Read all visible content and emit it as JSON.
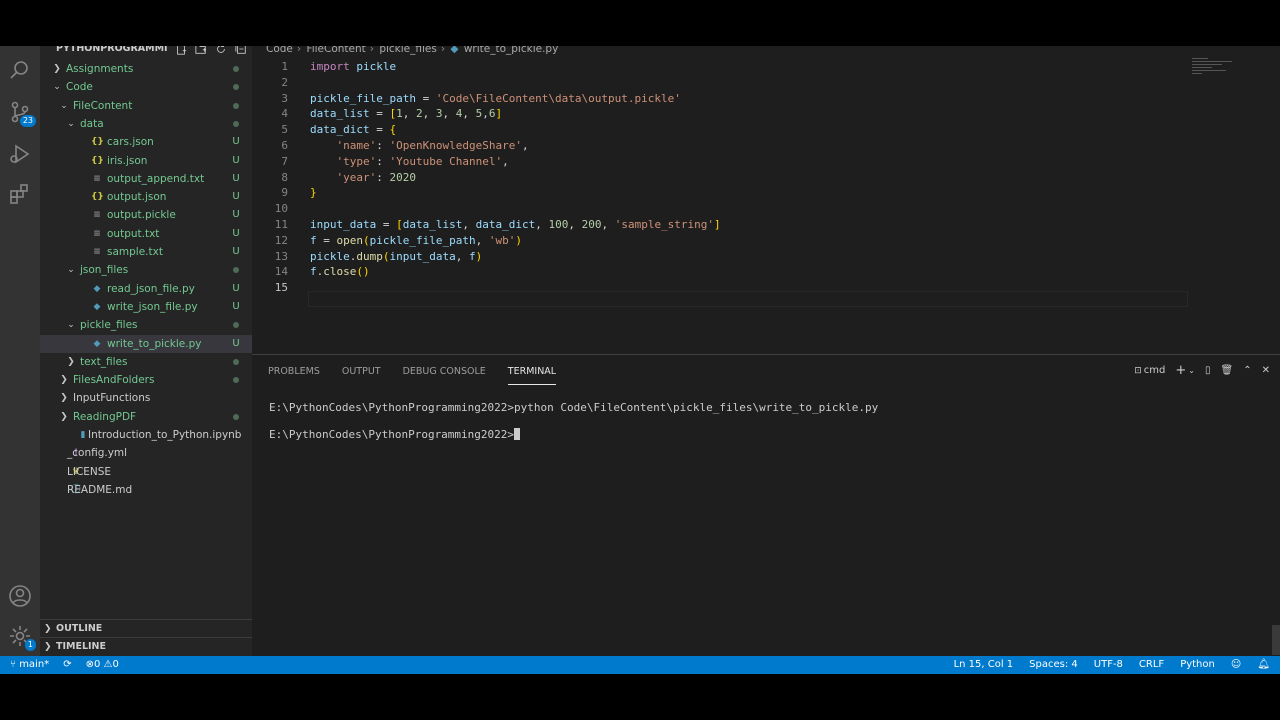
{
  "sidebar": {
    "title": "PYTHONPROGRAMMIN...",
    "tree": [
      {
        "label": "Assignments",
        "depth": 0,
        "kind": "folder",
        "expanded": false,
        "status": "dot"
      },
      {
        "label": "Code",
        "depth": 0,
        "kind": "folder",
        "expanded": true,
        "status": "dot"
      },
      {
        "label": "FileContent",
        "depth": 1,
        "kind": "folder",
        "expanded": true,
        "status": "dot"
      },
      {
        "label": "data",
        "depth": 2,
        "kind": "folder",
        "expanded": true,
        "status": "dot"
      },
      {
        "label": "cars.json",
        "depth": 3,
        "kind": "json",
        "status": "U"
      },
      {
        "label": "iris.json",
        "depth": 3,
        "kind": "json",
        "status": "U"
      },
      {
        "label": "output_append.txt",
        "depth": 3,
        "kind": "txt",
        "status": "U"
      },
      {
        "label": "output.json",
        "depth": 3,
        "kind": "json",
        "status": "U"
      },
      {
        "label": "output.pickle",
        "depth": 3,
        "kind": "txt",
        "status": "U"
      },
      {
        "label": "output.txt",
        "depth": 3,
        "kind": "txt",
        "status": "U"
      },
      {
        "label": "sample.txt",
        "depth": 3,
        "kind": "txt",
        "status": "U"
      },
      {
        "label": "json_files",
        "depth": 2,
        "kind": "folder",
        "expanded": true,
        "status": "dot"
      },
      {
        "label": "read_json_file.py",
        "depth": 3,
        "kind": "py",
        "status": "U"
      },
      {
        "label": "write_json_file.py",
        "depth": 3,
        "kind": "py",
        "status": "U"
      },
      {
        "label": "pickle_files",
        "depth": 2,
        "kind": "folder",
        "expanded": true,
        "status": "dot"
      },
      {
        "label": "write_to_pickle.py",
        "depth": 3,
        "kind": "py",
        "status": "U",
        "selected": true
      },
      {
        "label": "text_files",
        "depth": 2,
        "kind": "folder",
        "expanded": false,
        "status": "dot"
      },
      {
        "label": "FilesAndFolders",
        "depth": 1,
        "kind": "folder",
        "expanded": false,
        "status": "dot"
      },
      {
        "label": "InputFunctions",
        "depth": 1,
        "kind": "folder",
        "expanded": false,
        "status": ""
      },
      {
        "label": "ReadingPDF",
        "depth": 1,
        "kind": "folder",
        "expanded": false,
        "status": "dot"
      },
      {
        "label": "Introduction_to_Python.ipynb",
        "depth": 1,
        "kind": "nb",
        "status": ""
      },
      {
        "label": "_config.yml",
        "depth": 0,
        "kind": "yml",
        "status": ""
      },
      {
        "label": "LICENSE",
        "depth": 0,
        "kind": "license",
        "status": ""
      },
      {
        "label": "README.md",
        "depth": 0,
        "kind": "md",
        "status": ""
      }
    ],
    "outline_label": "OUTLINE",
    "timeline_label": "TIMELINE",
    "source_control_badge": "23",
    "settings_badge": "1"
  },
  "breadcrumb": [
    "Code",
    "FileContent",
    "pickle_files",
    "write_to_pickle.py"
  ],
  "editor": {
    "active_line": 15,
    "lines": [
      [
        [
          "kw",
          "import"
        ],
        [
          "op",
          " "
        ],
        [
          "id",
          "pickle"
        ]
      ],
      [],
      [
        [
          "id",
          "pickle_file_path"
        ],
        [
          "op",
          " = "
        ],
        [
          "st",
          "'Code\\FileContent\\data\\output.pickle'"
        ]
      ],
      [
        [
          "id",
          "data_list"
        ],
        [
          "op",
          " = "
        ],
        [
          "br",
          "["
        ],
        [
          "nu",
          "1"
        ],
        [
          "op",
          ", "
        ],
        [
          "nu",
          "2"
        ],
        [
          "op",
          ", "
        ],
        [
          "nu",
          "3"
        ],
        [
          "op",
          ", "
        ],
        [
          "nu",
          "4"
        ],
        [
          "op",
          ", "
        ],
        [
          "nu",
          "5"
        ],
        [
          "op",
          ","
        ],
        [
          "nu",
          "6"
        ],
        [
          "br",
          "]"
        ]
      ],
      [
        [
          "id",
          "data_dict"
        ],
        [
          "op",
          " = "
        ],
        [
          "br",
          "{"
        ]
      ],
      [
        [
          "op",
          "    "
        ],
        [
          "st",
          "'name'"
        ],
        [
          "op",
          ": "
        ],
        [
          "st",
          "'OpenKnowledgeShare'"
        ],
        [
          "op",
          ","
        ]
      ],
      [
        [
          "op",
          "    "
        ],
        [
          "st",
          "'type'"
        ],
        [
          "op",
          ": "
        ],
        [
          "st",
          "'Youtube Channel'"
        ],
        [
          "op",
          ","
        ]
      ],
      [
        [
          "op",
          "    "
        ],
        [
          "st",
          "'year'"
        ],
        [
          "op",
          ": "
        ],
        [
          "nu",
          "2020"
        ]
      ],
      [
        [
          "br",
          "}"
        ]
      ],
      [],
      [
        [
          "id",
          "input_data"
        ],
        [
          "op",
          " = "
        ],
        [
          "br",
          "["
        ],
        [
          "id",
          "data_list"
        ],
        [
          "op",
          ", "
        ],
        [
          "id",
          "data_dict"
        ],
        [
          "op",
          ", "
        ],
        [
          "nu",
          "100"
        ],
        [
          "op",
          ", "
        ],
        [
          "nu",
          "200"
        ],
        [
          "op",
          ", "
        ],
        [
          "st",
          "'sample_string'"
        ],
        [
          "br",
          "]"
        ]
      ],
      [
        [
          "id",
          "f"
        ],
        [
          "op",
          " = "
        ],
        [
          "fn",
          "open"
        ],
        [
          "br",
          "("
        ],
        [
          "id",
          "pickle_file_path"
        ],
        [
          "op",
          ", "
        ],
        [
          "st",
          "'wb'"
        ],
        [
          "br",
          ")"
        ]
      ],
      [
        [
          "id",
          "pickle"
        ],
        [
          "op",
          "."
        ],
        [
          "fn",
          "dump"
        ],
        [
          "br",
          "("
        ],
        [
          "id",
          "input_data"
        ],
        [
          "op",
          ", "
        ],
        [
          "id",
          "f"
        ],
        [
          "br",
          ")"
        ]
      ],
      [
        [
          "id",
          "f"
        ],
        [
          "op",
          "."
        ],
        [
          "fn",
          "close"
        ],
        [
          "br",
          "()"
        ]
      ],
      []
    ]
  },
  "panel": {
    "tabs": [
      "PROBLEMS",
      "OUTPUT",
      "DEBUG CONSOLE",
      "TERMINAL"
    ],
    "active_tab": "TERMINAL",
    "shell_label": "cmd",
    "terminal_lines": [
      "E:\\PythonCodes\\PythonProgramming2022>python Code\\FileContent\\pickle_files\\write_to_pickle.py",
      "E:\\PythonCodes\\PythonProgramming2022>"
    ]
  },
  "status": {
    "branch": "main*",
    "errors": "0",
    "warnings": "0",
    "position": "Ln 15, Col 1",
    "spaces": "Spaces: 4",
    "encoding": "UTF-8",
    "eol": "CRLF",
    "language": "Python"
  },
  "colors": {
    "accent": "#007acc",
    "untracked": "#73c991"
  }
}
